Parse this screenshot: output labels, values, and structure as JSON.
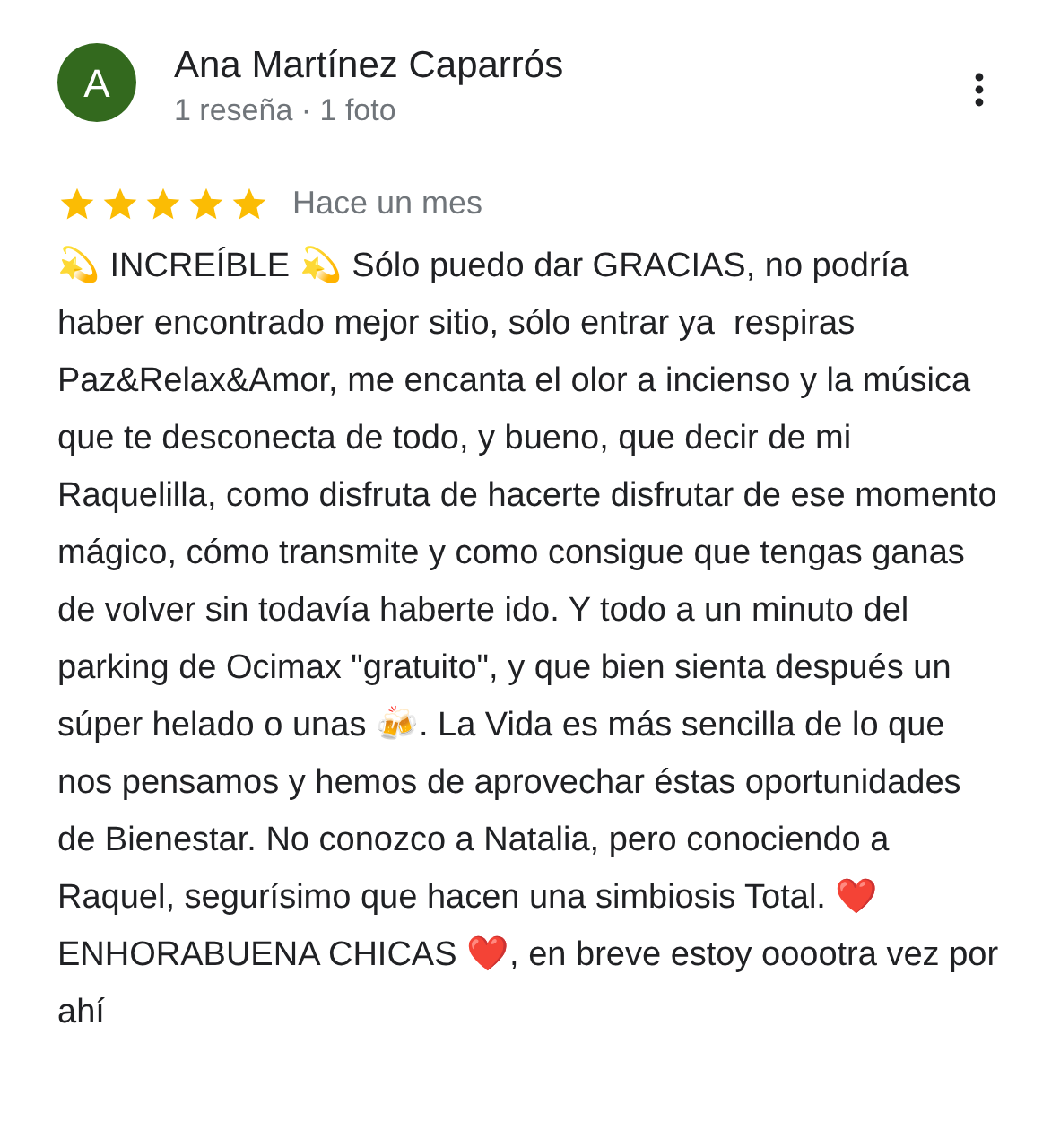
{
  "review": {
    "avatar_letter": "A",
    "author": "Ana Martínez Caparrós",
    "meta": "1 reseña · 1 foto",
    "stars": 5,
    "time": "Hace un mes",
    "text": "💫 INCREÍBLE 💫 Sólo puedo dar GRACIAS, no podría haber encontrado mejor sitio, sólo entrar ya  respiras Paz&Relax&Amor, me encanta el olor a incienso y la música que te desconecta de todo, y bueno, que decir de mi Raquelilla, como disfruta de hacerte disfrutar de ese momento mágico, cómo transmite y como consigue que tengas ganas de volver sin todavía haberte ido. Y todo a un minuto del parking de Ocimax \"gratuito\", y que bien sienta después un súper helado o unas 🍻. La Vida es más sencilla de lo que nos pensamos y hemos de aprovechar éstas oportunidades de Bienestar. No conozco a Natalia, pero conociendo a Raquel, segurísimo que hacen una simbiosis Total. ❤️ ENHORABUENA CHICAS ❤️, en breve estoy ooootra vez por ahí"
  }
}
